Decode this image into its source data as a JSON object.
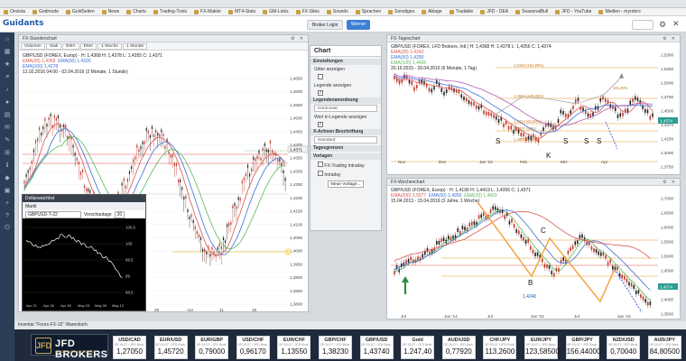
{
  "bookmarks": [
    "Onvista",
    "Godmode",
    "GoldSeiten",
    "News",
    "Charts",
    "Trading-Tools",
    "FX-Makler",
    "MT4-Stats",
    "GM-Links",
    "FX-Sites",
    "Sounds",
    "Sprachen",
    "Sonstiges",
    "Ablage",
    "Tradable",
    "JFD - DEA",
    "SeasonalBull",
    "JFD - YouTube",
    "Medien - myrebro"
  ],
  "app": {
    "logo": "Guidants",
    "btn_left": "Broker Login",
    "btn_right": "Werner"
  },
  "left_chart": {
    "title": "FX-Stundenchart",
    "toolbar": [
      "Volumen",
      "Stak",
      "EMA",
      "EMA",
      "1 Woche",
      "1 Stunde"
    ],
    "legend_line1": "GBP/USD (FOREX, Europ) · H: 1,4368  H: 1,4378  L: 1,4355  C: 1,4371",
    "legend_ema20": "EMA(20)  1,4369",
    "legend_ema50": "EMA(50)  1,4326",
    "legend_ema100": "EMA(100)  1,4278",
    "legend_line3": "12.02.2016 04:00 - 02.04.2016 (2 Monate, 1 Stunde)",
    "yticks": [
      "1,4650",
      "1,4600",
      "1,4550",
      "1,4500",
      "1,4450",
      "1,4400",
      "1,4350",
      "1,4300",
      "1,4250",
      "1,4200",
      "1,4150",
      "1,4100",
      "1,4050",
      "1,4000",
      "1,3950",
      "1,3900",
      "1,3850",
      "1,3800"
    ],
    "price_tag": "1,4371",
    "xticks": [
      "29",
      "Apr",
      "11",
      "18"
    ]
  },
  "settings": {
    "header": "Chart",
    "g_settings": "Einstellungen",
    "gitter": "Gitter anzeigen",
    "legende": "Legende anzeigen",
    "legendenanordnung": "Legendenanordnung",
    "horizontal": "Horizontal",
    "wert_legende": "Wert in Legende anzeigen",
    "xachse": "X-Achsen Beschriftung",
    "standard": "Standard",
    "tagesgrenzen": "Tagesgrenzen",
    "vorlagen": "Vorlagen",
    "vorlage1": "FX-Trading Intraday",
    "vorlage2": "Intraday",
    "neue_vorlage": "Neue Vorlage..."
  },
  "mini_chart": {
    "title": "Dollarwatchlist",
    "tab": "Markt",
    "symbol": "GBPUSD-T-22",
    "label": "Vorschautage",
    "days": "20",
    "yticks": [
      "100,5",
      "100",
      "99,5",
      "99",
      "98,5"
    ],
    "xticks": [
      "Apr 21",
      "Apr 28",
      "Apr 28",
      "May 03",
      "May 05",
      "May 12"
    ]
  },
  "right_top": {
    "title": "FX-Tageschart",
    "legend_line1": "GBP/USD (FOREX, LFD Brokers, Intl.) H: 1,4368  H: 1,4378  L: 1,4356  C: 1,4374",
    "legend_ema20": "EMA(20)  1,4243",
    "legend_ema50": "EMA(50)  1,4290",
    "legend_ema100": "EMA(100)  1,4405",
    "legend_line3": "20.10.2015 - 20.04.2016 (6 Monate, 1 Tag)",
    "fib_labels": [
      "1,5183 (161,80%)",
      "1,4654 (100,00%)",
      "1,4414 (61,80%)",
      "1,4307 (50%)",
      "1,3838 (0,00%)",
      "161,80%",
      "1,4374"
    ],
    "s_marks": [
      "S",
      "S",
      "S",
      "S",
      "K"
    ],
    "yticks": [
      "1,5300",
      "1,5250",
      "1,5000",
      "1,4750",
      "1,4500",
      "1,4374",
      "1,4250",
      "1,4000",
      "1,3750"
    ],
    "xticks": [
      "Nov",
      "Dez",
      "Jan '16",
      "Feb",
      "Mrz",
      "Apr"
    ]
  },
  "right_bottom": {
    "title": "FX-Wochenchart",
    "legend_line1": "GBP/USD (FOREX, Europ) · H: 1,4190  H: 1,4419  L: 1,4356  C: 1,4371",
    "legend_ema200": "EMA(200)  1,5577",
    "legend_ema50": "EMA(50)  1,4950",
    "legend_ema20": "EMA(20)  1,4603",
    "legend_line3": "15.04.2013 - 15.04.2016 (3 Jahre, 1 Woche)",
    "label_a": "A",
    "label_b": "B",
    "label_c": "C",
    "value_1424": "1,4240",
    "yticks": [
      "1,7000",
      "1,6500",
      "1,6000",
      "1,5500",
      "1,5000",
      "1,4500",
      "1,4374",
      "1,4000",
      "1,3500"
    ],
    "xticks": [
      "Jul",
      "Jan '14",
      "Jul",
      "Jan '15",
      "Jul",
      "Jan '16"
    ]
  },
  "ticker": {
    "title": "Inventar \"Forex-FX-15\" Warenkorb",
    "brand": "JFD BROKERS",
    "tag": "JUST FAIR AND DIRECT",
    "emblem": "JFD",
    "quotes": [
      {
        "sym": "USD/CAD",
        "sub": "0P:15.07 / JFD Brok.",
        "val": "1,27050"
      },
      {
        "sym": "EUR/USD",
        "sub": "0P:15.07 / JFD Brok.",
        "val": "1,45720"
      },
      {
        "sym": "EUR/GBP",
        "sub": "0P:15.07 / JFD Brok.",
        "val": "0,79000"
      },
      {
        "sym": "USD/CHF",
        "sub": "0P:15.07 / JFD Brok.",
        "val": "0,96170"
      },
      {
        "sym": "EUR/CHF",
        "sub": "0P:15.07 / JFD Brok.",
        "val": "1,13550"
      },
      {
        "sym": "GBP/CHF",
        "sub": "0P:15.07 / JFD Brok.",
        "val": "1,38230"
      },
      {
        "sym": "GBP/USD",
        "sub": "0P:15.07 / JFD Brok.",
        "val": "1,43740"
      },
      {
        "sym": "Gold",
        "sub": "0P:15.07 / JFD Brok.",
        "val": "1.247,40"
      },
      {
        "sym": "AUD/USD",
        "sub": "0P:15.07 / JFD Brok.",
        "val": "0,77920"
      },
      {
        "sym": "CHF/JPY",
        "sub": "0P:15.07 / JFD Brok.",
        "val": "113,2600"
      },
      {
        "sym": "EUR/JPY",
        "sub": "0P:15.07 / JFD Brok.",
        "val": "123,58500"
      },
      {
        "sym": "GBP/JPY",
        "sub": "0P:15.07 / JFD Brok.",
        "val": "156,44000"
      },
      {
        "sym": "NZD/USD",
        "sub": "0P:15.07 / JFD Brok.",
        "val": "0,70040"
      },
      {
        "sym": "AUD/JPY",
        "sub": "0P:15.07 / JFD Brok.",
        "val": "84,80500"
      }
    ]
  },
  "colors": {
    "nav": "#2c3e57",
    "candle_red": "#c0392b",
    "candle_dark": "#222222",
    "ema_red": "#d9534f",
    "ema_blue": "#3b6fd6",
    "ema_green": "#5cb85c",
    "fib_orange": "#e6962e",
    "abc_orange": "#f0a030",
    "arrow_green": "#2e8b3a",
    "arrow_blue": "#2a52be"
  }
}
